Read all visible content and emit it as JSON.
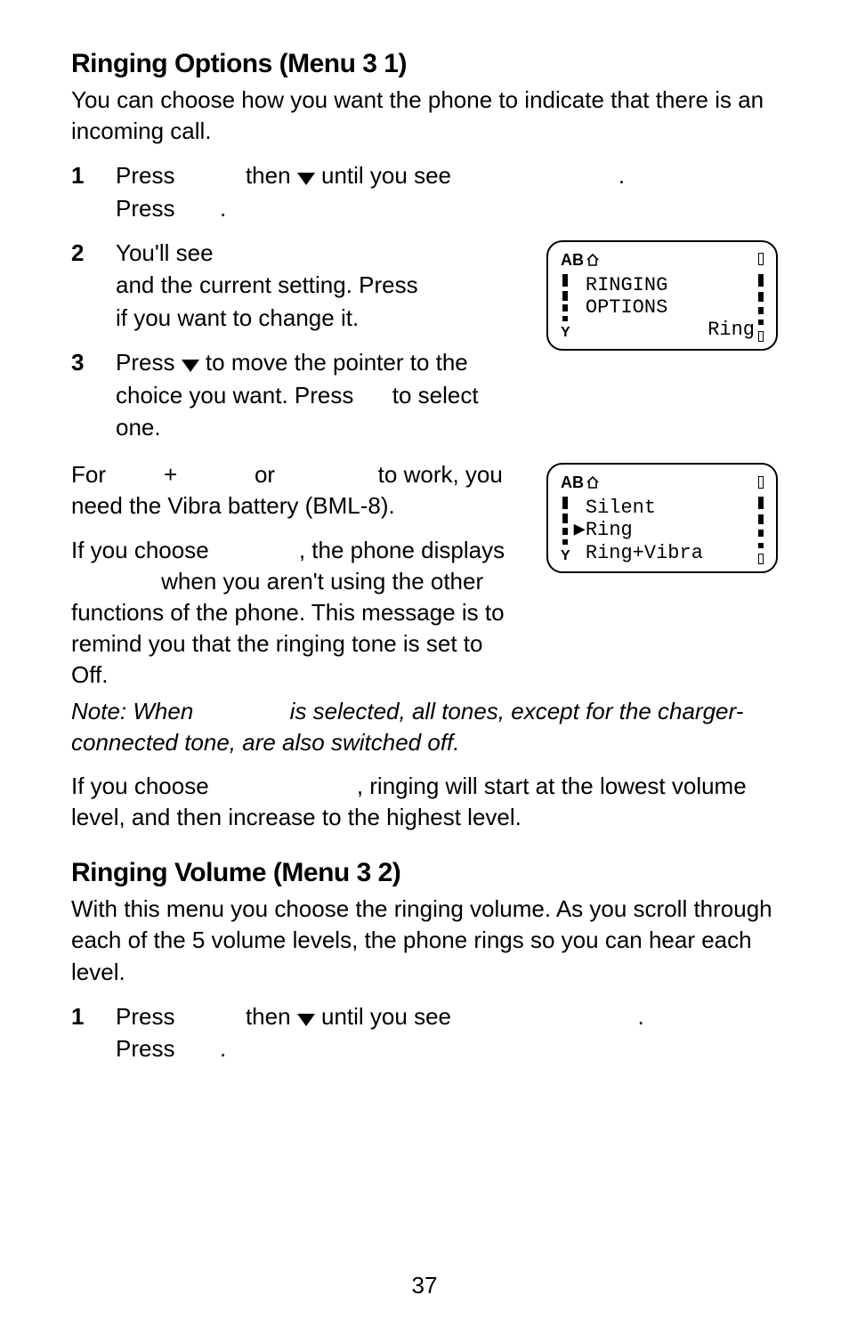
{
  "page_number": "37",
  "section1": {
    "heading": "Ringing Options (Menu 3 1)",
    "intro": "You can choose how you want the phone to indicate that there is an incoming call.",
    "step1_a": "Press ",
    "step1_b": " then ",
    "step1_c": " until you see ",
    "step1_d": ".",
    "step1_e": "Press ",
    "step1_f": ".",
    "step2_a": "You'll see ",
    "step2_b": "and the current setting. Press ",
    "step2_c": "if you want to change it.",
    "step3_a": "Press ",
    "step3_b": " to move the pointer to the choice you want. Press ",
    "step3_c": " to select one.",
    "vibra_a": "For ",
    "vibra_b": " + ",
    "vibra_c": " or ",
    "vibra_d": " to work, you need the Vibra battery (BML-8).",
    "silent_a": "If you choose ",
    "silent_b": ", the phone displays ",
    "silent_c": " when you aren't using the other functions of the phone. This message is to remind you that the ringing tone is set to Off.",
    "note_a": "Note: When ",
    "note_b": " is selected, all tones, except for the charger-connected tone, are also switched off.",
    "ascend_a": "If you choose ",
    "ascend_b": ", ringing will start at the lowest volume level, and then increase to the highest level."
  },
  "section2": {
    "heading": "Ringing Volume (Menu 3 2)",
    "intro": "With this menu you choose the ringing volume. As you scroll through each of the 5 volume levels, the phone rings so you can hear each level.",
    "step1_a": "Press ",
    "step1_b": " then ",
    "step1_c": " until you see ",
    "step1_d": ".",
    "step1_e": "Press ",
    "step1_f": "."
  },
  "screen1": {
    "indicator": "AB",
    "line1": " RINGING",
    "line2": " OPTIONS",
    "line3": "Ring"
  },
  "screen2": {
    "indicator": "AB",
    "line1": " Silent",
    "line2": "▶Ring",
    "line3": " Ring+Vibra"
  },
  "icons": {
    "down_arrow": "down-arrow-icon",
    "home": "home-icon",
    "battery": "battery-icon",
    "signal": "signal-icon"
  }
}
